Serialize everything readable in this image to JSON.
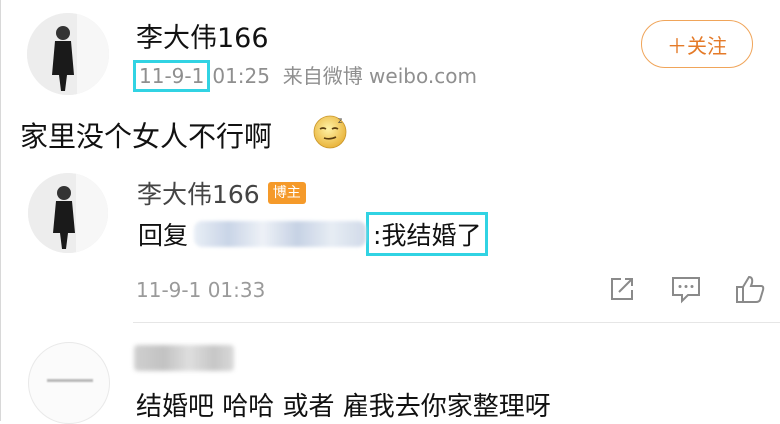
{
  "post": {
    "author": "李大伟166",
    "date": "11-9-1",
    "time": "01:25",
    "source": "来自微博 weibo.com",
    "follow_label": "＋关注",
    "text": "家里没个女人不行啊"
  },
  "reply": {
    "author": "李大伟166",
    "badge": "博主",
    "prefix": "回复",
    "suffix": ":我结婚了",
    "timestamp": "11-9-1 01:33"
  },
  "comment": {
    "text": "结婚吧 哈哈  或者  雇我去你家整理呀"
  },
  "icons": [
    "share-icon",
    "comment-icon",
    "like-icon"
  ],
  "colors": {
    "highlight": "#31d3e3",
    "accent": "#e47a28",
    "badge": "#f59a2a"
  }
}
